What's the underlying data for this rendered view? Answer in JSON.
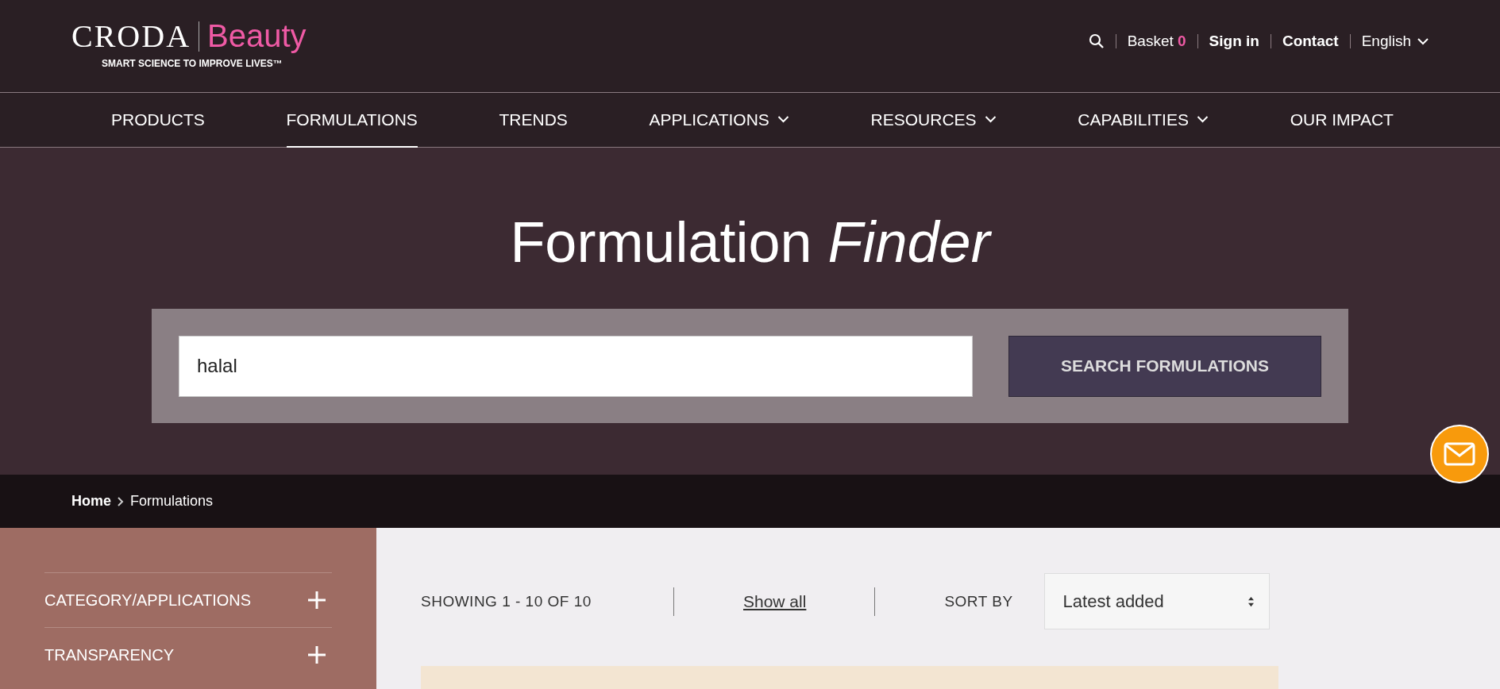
{
  "header": {
    "logo": {
      "brand": "CRODA",
      "product": "Beauty",
      "tagline": "SMART SCIENCE TO IMPROVE LIVES™"
    },
    "utility_links": [
      {
        "kind": "search"
      },
      {
        "kind": "basket",
        "label": "Basket",
        "count": "0"
      },
      {
        "kind": "link",
        "label": "Sign in"
      },
      {
        "kind": "link",
        "label": "Contact"
      },
      {
        "kind": "language",
        "label": "English"
      }
    ]
  },
  "nav": [
    {
      "label": "PRODUCTS",
      "selected": false,
      "dropdown": false
    },
    {
      "label": "FORMULATIONS",
      "selected": true,
      "dropdown": false
    },
    {
      "label": "TRENDS",
      "selected": false,
      "dropdown": false
    },
    {
      "label": "APPLICATIONS",
      "selected": false,
      "dropdown": true
    },
    {
      "label": "RESOURCES",
      "selected": false,
      "dropdown": true
    },
    {
      "label": "CAPABILITIES",
      "selected": false,
      "dropdown": true
    },
    {
      "label": "OUR IMPACT",
      "selected": false,
      "dropdown": false
    }
  ],
  "hero": {
    "title": "Formulation *Finder*",
    "search": {
      "value": "halal",
      "button": "SEARCH FORMULATIONS"
    }
  },
  "breadcrumb": [
    {
      "label": "Home",
      "current": false
    },
    {
      "label": "Formulations",
      "current": true
    }
  ],
  "filters": [
    {
      "label": "CATEGORY/APPLICATIONS",
      "expanded": false
    },
    {
      "label": "TRANSPARENCY",
      "expanded": false
    }
  ],
  "results": {
    "showing": "SHOWING 1 - 10 OF 10",
    "show_all": "Show all",
    "sort_label": "SORT BY",
    "sort_value": "Latest added"
  }
}
